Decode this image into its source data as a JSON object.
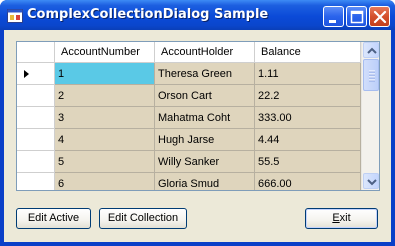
{
  "window": {
    "title": "ComplexCollectionDialog Sample",
    "controls": [
      "minimize-icon",
      "maximize-icon",
      "close-icon"
    ]
  },
  "grid": {
    "columns": [
      "AccountNumber",
      "AccountHolder",
      "Balance"
    ],
    "rows": [
      [
        "1",
        "Theresa Green",
        "1.11"
      ],
      [
        "2",
        "Orson Cart",
        "22.2"
      ],
      [
        "3",
        "Mahatma Coht",
        "333.00"
      ],
      [
        "4",
        "Hugh Jarse",
        "4.44"
      ],
      [
        "5",
        "Willy Sanker",
        "55.5"
      ],
      [
        "6",
        "Gloria Smud",
        "666.00"
      ]
    ],
    "current_row_indicator": "row-selector-arrow-icon"
  },
  "buttons": {
    "edit_active": "Edit Active",
    "edit_collection": "Edit Collection",
    "exit_mnemonic": "E",
    "exit_rest": "xit"
  },
  "colors": {
    "title_bar": "#0b4ad8",
    "selected_cell": "#5ac9e6",
    "cell_background": "#dfd5bd",
    "dialog_background": "#ece9d8"
  }
}
